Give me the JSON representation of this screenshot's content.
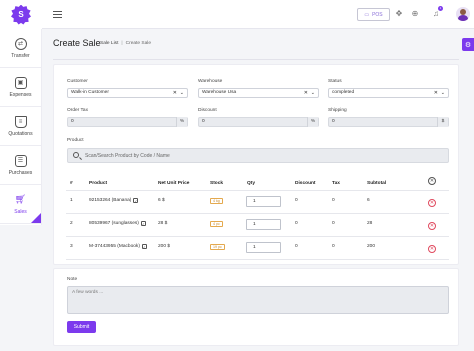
{
  "app": {
    "logo_letter": "S",
    "brand_color": "#7c3aed"
  },
  "topbar": {
    "pos_label": "POS",
    "notification_count": "1"
  },
  "sidebar": {
    "items": [
      {
        "label": "Transfer",
        "icon": "transfer-icon"
      },
      {
        "label": "Expenses",
        "icon": "expenses-icon"
      },
      {
        "label": "Quotations",
        "icon": "basket-icon"
      },
      {
        "label": "Purchases",
        "icon": "receipt-icon"
      },
      {
        "label": "Sales",
        "icon": "cart-icon",
        "active": true
      }
    ]
  },
  "page": {
    "title": "Create Sale",
    "breadcrumb_parent": "Sale List",
    "breadcrumb_sep": "|",
    "breadcrumb_current": "Create Sale"
  },
  "form": {
    "customer": {
      "label": "Customer",
      "value": "Walk-in Customer"
    },
    "warehouse": {
      "label": "Warehouse",
      "value": "Warehouse Usa"
    },
    "status": {
      "label": "Status",
      "value": "completed"
    },
    "order_tax": {
      "label": "Order Tax",
      "value": "0",
      "unit": "%"
    },
    "discount": {
      "label": "Discount",
      "value": "0",
      "unit": "%"
    },
    "shipping": {
      "label": "Shipping",
      "value": "0",
      "unit": "$"
    },
    "product": {
      "label": "Product",
      "placeholder": "Scan/Search Product by Code / Name"
    },
    "note": {
      "label": "Note",
      "placeholder": "A few words ..."
    },
    "submit_label": "Submit"
  },
  "table": {
    "headers": [
      "#",
      "Product",
      "Net Unit Price",
      "Stock",
      "Qty",
      "Discount",
      "Tax",
      "Subtotal"
    ],
    "rows": [
      {
        "num": "1",
        "product": "92153264 (Banana)",
        "price": "6 $",
        "stock": "4 kg",
        "qty": "1",
        "discount": "0",
        "tax": "0",
        "subtotal": "6"
      },
      {
        "num": "2",
        "product": "80539967 (sunglasses)",
        "price": "28 $",
        "stock": "4 pc",
        "qty": "1",
        "discount": "0",
        "tax": "0",
        "subtotal": "28"
      },
      {
        "num": "3",
        "product": "M-37443955 (Macbook)",
        "price": "200 $",
        "stock": "19 pc",
        "qty": "1",
        "discount": "0",
        "tax": "0",
        "subtotal": "200"
      }
    ]
  }
}
